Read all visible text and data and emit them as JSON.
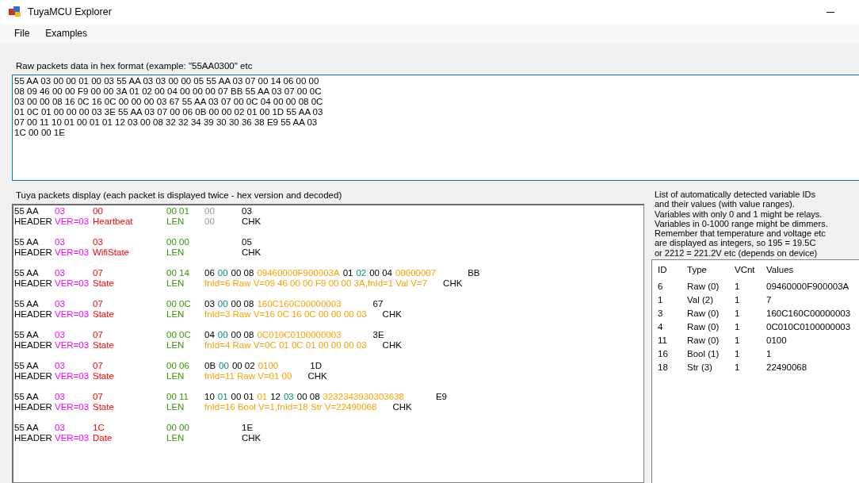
{
  "window": {
    "title": "TuyaMCU Explorer"
  },
  "menu": [
    {
      "label": "File"
    },
    {
      "label": "Examples"
    }
  ],
  "raw_input": {
    "label": "Raw packets data in hex format (example: \"55AA0300\" etc",
    "lines": [
      "55 AA 03 00 00 01 00 03 55 AA 03 03 00 00 05 55 AA 03 07 00 14 06 00 00",
      "08 09 46 00 00 F9 00 00 3A 01 02 00 04 00 00 00 07 BB 55 AA 03 07 00 0C",
      "03 00 00 08 16 0C 16 0C 00 00 00 03 67 55 AA 03 07 00 0C 04 00 00 08 0C",
      "01 0C 01 00 00 00 03 3E 55 AA 03 07 00 06 0B 00 00 02 01 00 1D 55 AA 03",
      "07 00 11 10 01 00 01 01 12 03 00 08 32 32 34 39 30 30 36 38 E9 55 AA 03",
      "1C 00 00 1E"
    ]
  },
  "packets_display": {
    "label": "Tuya packets display (each packet is displayed twice - hex version and decoded)",
    "packets": [
      {
        "hex": {
          "header": "55 AA",
          "version": "03",
          "command": "00",
          "length": "00 01",
          "data": [
            {
              "text": "00",
              "kind": "payload"
            }
          ],
          "checksum": "03"
        },
        "decoded": {
          "header": "HEADER",
          "version": "VER=03",
          "command": "Heartbeat",
          "length": "LEN",
          "data": [
            {
              "text": "00",
              "kind": "payload"
            }
          ],
          "checksum": "CHK"
        }
      },
      {
        "hex": {
          "header": "55 AA",
          "version": "03",
          "command": "03",
          "length": "00 00",
          "checksum": "05"
        },
        "decoded": {
          "header": "HEADER",
          "version": "VER=03",
          "command": "WifiState",
          "length": "LEN",
          "checksum": "CHK"
        }
      },
      {
        "hex": {
          "header": "55 AA",
          "version": "03",
          "command": "07",
          "length": "00 14",
          "data": [
            {
              "text": "06",
              "kind": "id"
            },
            {
              "text": "00",
              "kind": "type"
            },
            {
              "text": "00 08",
              "kind": "size"
            },
            {
              "text": "09460000F900003A",
              "kind": "value"
            },
            {
              "text": "01",
              "kind": "id"
            },
            {
              "text": "02",
              "kind": "type"
            },
            {
              "text": "00 04",
              "kind": "size"
            },
            {
              "text": "00000007",
              "kind": "value"
            }
          ],
          "checksum": "BB"
        },
        "decoded": {
          "header": "HEADER",
          "version": "VER=03",
          "command": "State",
          "length": "LEN",
          "data": [
            {
              "text": "fnId=6 Raw V=09 46 00 00 F9 00 00 3A,fnId=1 Val V=7",
              "kind": "value"
            }
          ],
          "checksum": "CHK"
        }
      },
      {
        "hex": {
          "header": "55 AA",
          "version": "03",
          "command": "07",
          "length": "00 0C",
          "data": [
            {
              "text": "03",
              "kind": "id"
            },
            {
              "text": "00",
              "kind": "type"
            },
            {
              "text": "00 08",
              "kind": "size"
            },
            {
              "text": "160C160C00000003",
              "kind": "value"
            }
          ],
          "checksum": "67"
        },
        "decoded": {
          "header": "HEADER",
          "version": "VER=03",
          "command": "State",
          "length": "LEN",
          "data": [
            {
              "text": "fnId=3 Raw V=16 0C 16 0C 00 00 00 03",
              "kind": "value"
            }
          ],
          "checksum": "CHK"
        }
      },
      {
        "hex": {
          "header": "55 AA",
          "version": "03",
          "command": "07",
          "length": "00 0C",
          "data": [
            {
              "text": "04",
              "kind": "id"
            },
            {
              "text": "00",
              "kind": "type"
            },
            {
              "text": "00 08",
              "kind": "size"
            },
            {
              "text": "0C010C0100000003",
              "kind": "value"
            }
          ],
          "checksum": "3E"
        },
        "decoded": {
          "header": "HEADER",
          "version": "VER=03",
          "command": "State",
          "length": "LEN",
          "data": [
            {
              "text": "fnId=4 Raw V=0C 01 0C 01 00 00 00 03",
              "kind": "value"
            }
          ],
          "checksum": "CHK"
        }
      },
      {
        "hex": {
          "header": "55 AA",
          "version": "03",
          "command": "07",
          "length": "00 06",
          "data": [
            {
              "text": "0B",
              "kind": "id"
            },
            {
              "text": "00",
              "kind": "type"
            },
            {
              "text": "00 02",
              "kind": "size"
            },
            {
              "text": "0100",
              "kind": "value"
            }
          ],
          "checksum": "1D"
        },
        "decoded": {
          "header": "HEADER",
          "version": "VER=03",
          "command": "State",
          "length": "LEN",
          "data": [
            {
              "text": "fnId=11 Raw V=01 00",
              "kind": "value"
            }
          ],
          "checksum": "CHK"
        }
      },
      {
        "hex": {
          "header": "55 AA",
          "version": "03",
          "command": "07",
          "length": "00 11",
          "data": [
            {
              "text": "10",
              "kind": "id"
            },
            {
              "text": "01",
              "kind": "type"
            },
            {
              "text": "00 01",
              "kind": "size"
            },
            {
              "text": "01",
              "kind": "value"
            },
            {
              "text": "12",
              "kind": "id"
            },
            {
              "text": "03",
              "kind": "type"
            },
            {
              "text": "00 08",
              "kind": "size"
            },
            {
              "text": "3232343930303638",
              "kind": "value"
            }
          ],
          "checksum": "E9"
        },
        "decoded": {
          "header": "HEADER",
          "version": "VER=03",
          "command": "State",
          "length": "LEN",
          "data": [
            {
              "text": "fnId=16 Bool V=1,fnId=18 Str V=22490068",
              "kind": "value"
            }
          ],
          "checksum": "CHK"
        }
      },
      {
        "hex": {
          "header": "55 AA",
          "version": "03",
          "command": "1C",
          "length": "00 00",
          "checksum": "1E"
        },
        "decoded": {
          "header": "HEADER",
          "version": "VER=03",
          "command": "Date",
          "length": "LEN",
          "checksum": "CHK"
        }
      }
    ]
  },
  "variables": {
    "description": [
      "List of automatically detected variable IDs",
      "and their values (with value ranges).",
      "Variables with only 0 and 1 might be relays.",
      "Variables in 0-1000 range might be dimmers.",
      "Remember that temperature and voltage etc",
      "are displayed as integers, so 195 = 19.5C",
      "or 2212 = 221.2V etc (depends on device)"
    ],
    "columns": [
      "ID",
      "Type",
      "VCnt",
      "Values"
    ],
    "rows": [
      [
        "6",
        "Raw (0)",
        "1",
        "09460000F900003A"
      ],
      [
        "1",
        "Val (2)",
        "1",
        "7"
      ],
      [
        "3",
        "Raw (0)",
        "1",
        "160C160C00000003"
      ],
      [
        "4",
        "Raw (0)",
        "1",
        "0C010C0100000003"
      ],
      [
        "11",
        "Raw (0)",
        "1",
        "0100"
      ],
      [
        "16",
        "Bool (1)",
        "1",
        "1"
      ],
      [
        "18",
        "Str (3)",
        "1",
        "22490068"
      ]
    ]
  }
}
